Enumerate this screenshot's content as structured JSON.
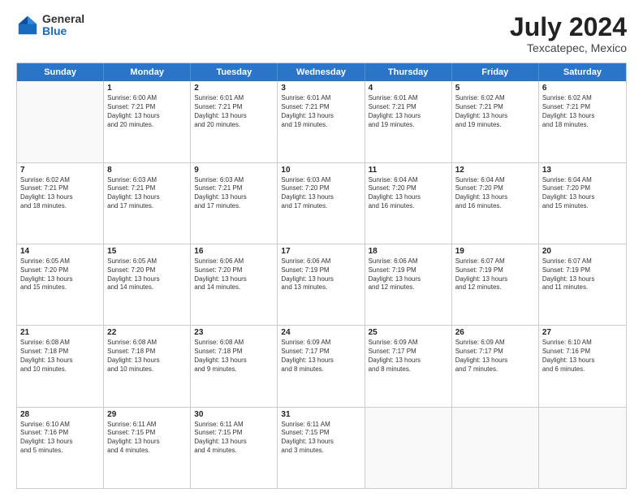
{
  "logo": {
    "general": "General",
    "blue": "Blue"
  },
  "title": {
    "month_year": "July 2024",
    "location": "Texcatepec, Mexico"
  },
  "calendar": {
    "days_of_week": [
      "Sunday",
      "Monday",
      "Tuesday",
      "Wednesday",
      "Thursday",
      "Friday",
      "Saturday"
    ],
    "weeks": [
      [
        {
          "day": "",
          "lines": []
        },
        {
          "day": "1",
          "lines": [
            "Sunrise: 6:00 AM",
            "Sunset: 7:21 PM",
            "Daylight: 13 hours",
            "and 20 minutes."
          ]
        },
        {
          "day": "2",
          "lines": [
            "Sunrise: 6:01 AM",
            "Sunset: 7:21 PM",
            "Daylight: 13 hours",
            "and 20 minutes."
          ]
        },
        {
          "day": "3",
          "lines": [
            "Sunrise: 6:01 AM",
            "Sunset: 7:21 PM",
            "Daylight: 13 hours",
            "and 19 minutes."
          ]
        },
        {
          "day": "4",
          "lines": [
            "Sunrise: 6:01 AM",
            "Sunset: 7:21 PM",
            "Daylight: 13 hours",
            "and 19 minutes."
          ]
        },
        {
          "day": "5",
          "lines": [
            "Sunrise: 6:02 AM",
            "Sunset: 7:21 PM",
            "Daylight: 13 hours",
            "and 19 minutes."
          ]
        },
        {
          "day": "6",
          "lines": [
            "Sunrise: 6:02 AM",
            "Sunset: 7:21 PM",
            "Daylight: 13 hours",
            "and 18 minutes."
          ]
        }
      ],
      [
        {
          "day": "7",
          "lines": [
            "Sunrise: 6:02 AM",
            "Sunset: 7:21 PM",
            "Daylight: 13 hours",
            "and 18 minutes."
          ]
        },
        {
          "day": "8",
          "lines": [
            "Sunrise: 6:03 AM",
            "Sunset: 7:21 PM",
            "Daylight: 13 hours",
            "and 17 minutes."
          ]
        },
        {
          "day": "9",
          "lines": [
            "Sunrise: 6:03 AM",
            "Sunset: 7:21 PM",
            "Daylight: 13 hours",
            "and 17 minutes."
          ]
        },
        {
          "day": "10",
          "lines": [
            "Sunrise: 6:03 AM",
            "Sunset: 7:20 PM",
            "Daylight: 13 hours",
            "and 17 minutes."
          ]
        },
        {
          "day": "11",
          "lines": [
            "Sunrise: 6:04 AM",
            "Sunset: 7:20 PM",
            "Daylight: 13 hours",
            "and 16 minutes."
          ]
        },
        {
          "day": "12",
          "lines": [
            "Sunrise: 6:04 AM",
            "Sunset: 7:20 PM",
            "Daylight: 13 hours",
            "and 16 minutes."
          ]
        },
        {
          "day": "13",
          "lines": [
            "Sunrise: 6:04 AM",
            "Sunset: 7:20 PM",
            "Daylight: 13 hours",
            "and 15 minutes."
          ]
        }
      ],
      [
        {
          "day": "14",
          "lines": [
            "Sunrise: 6:05 AM",
            "Sunset: 7:20 PM",
            "Daylight: 13 hours",
            "and 15 minutes."
          ]
        },
        {
          "day": "15",
          "lines": [
            "Sunrise: 6:05 AM",
            "Sunset: 7:20 PM",
            "Daylight: 13 hours",
            "and 14 minutes."
          ]
        },
        {
          "day": "16",
          "lines": [
            "Sunrise: 6:06 AM",
            "Sunset: 7:20 PM",
            "Daylight: 13 hours",
            "and 14 minutes."
          ]
        },
        {
          "day": "17",
          "lines": [
            "Sunrise: 6:06 AM",
            "Sunset: 7:19 PM",
            "Daylight: 13 hours",
            "and 13 minutes."
          ]
        },
        {
          "day": "18",
          "lines": [
            "Sunrise: 6:06 AM",
            "Sunset: 7:19 PM",
            "Daylight: 13 hours",
            "and 12 minutes."
          ]
        },
        {
          "day": "19",
          "lines": [
            "Sunrise: 6:07 AM",
            "Sunset: 7:19 PM",
            "Daylight: 13 hours",
            "and 12 minutes."
          ]
        },
        {
          "day": "20",
          "lines": [
            "Sunrise: 6:07 AM",
            "Sunset: 7:19 PM",
            "Daylight: 13 hours",
            "and 11 minutes."
          ]
        }
      ],
      [
        {
          "day": "21",
          "lines": [
            "Sunrise: 6:08 AM",
            "Sunset: 7:18 PM",
            "Daylight: 13 hours",
            "and 10 minutes."
          ]
        },
        {
          "day": "22",
          "lines": [
            "Sunrise: 6:08 AM",
            "Sunset: 7:18 PM",
            "Daylight: 13 hours",
            "and 10 minutes."
          ]
        },
        {
          "day": "23",
          "lines": [
            "Sunrise: 6:08 AM",
            "Sunset: 7:18 PM",
            "Daylight: 13 hours",
            "and 9 minutes."
          ]
        },
        {
          "day": "24",
          "lines": [
            "Sunrise: 6:09 AM",
            "Sunset: 7:17 PM",
            "Daylight: 13 hours",
            "and 8 minutes."
          ]
        },
        {
          "day": "25",
          "lines": [
            "Sunrise: 6:09 AM",
            "Sunset: 7:17 PM",
            "Daylight: 13 hours",
            "and 8 minutes."
          ]
        },
        {
          "day": "26",
          "lines": [
            "Sunrise: 6:09 AM",
            "Sunset: 7:17 PM",
            "Daylight: 13 hours",
            "and 7 minutes."
          ]
        },
        {
          "day": "27",
          "lines": [
            "Sunrise: 6:10 AM",
            "Sunset: 7:16 PM",
            "Daylight: 13 hours",
            "and 6 minutes."
          ]
        }
      ],
      [
        {
          "day": "28",
          "lines": [
            "Sunrise: 6:10 AM",
            "Sunset: 7:16 PM",
            "Daylight: 13 hours",
            "and 5 minutes."
          ]
        },
        {
          "day": "29",
          "lines": [
            "Sunrise: 6:11 AM",
            "Sunset: 7:15 PM",
            "Daylight: 13 hours",
            "and 4 minutes."
          ]
        },
        {
          "day": "30",
          "lines": [
            "Sunrise: 6:11 AM",
            "Sunset: 7:15 PM",
            "Daylight: 13 hours",
            "and 4 minutes."
          ]
        },
        {
          "day": "31",
          "lines": [
            "Sunrise: 6:11 AM",
            "Sunset: 7:15 PM",
            "Daylight: 13 hours",
            "and 3 minutes."
          ]
        },
        {
          "day": "",
          "lines": []
        },
        {
          "day": "",
          "lines": []
        },
        {
          "day": "",
          "lines": []
        }
      ]
    ]
  }
}
